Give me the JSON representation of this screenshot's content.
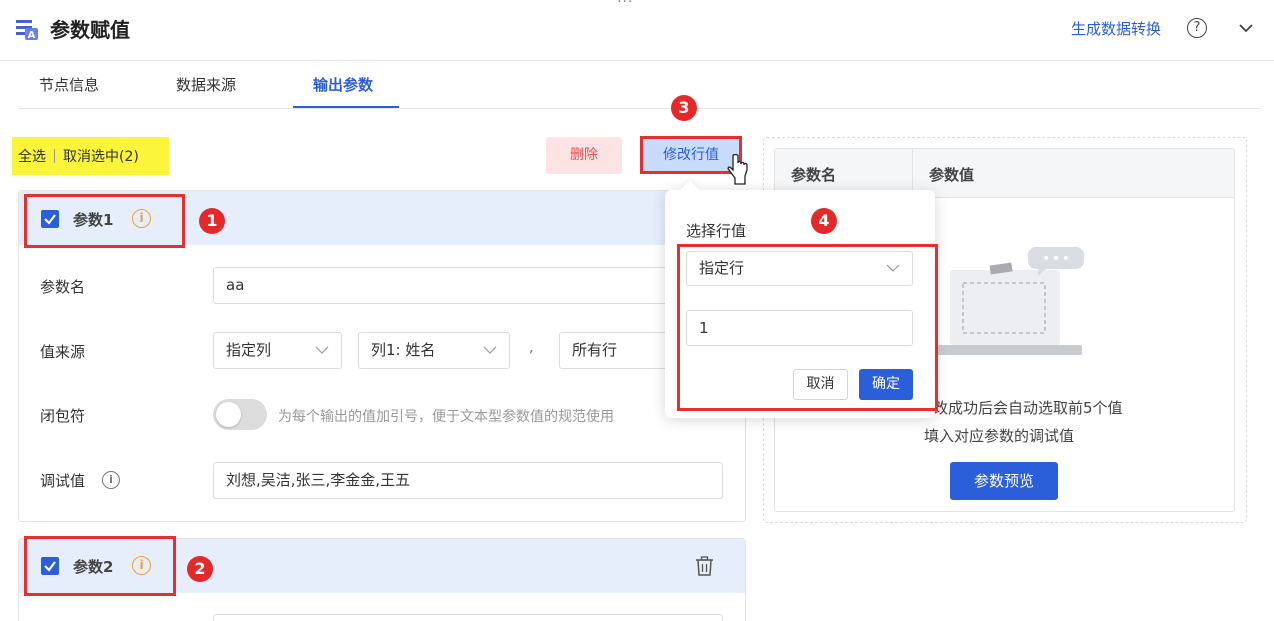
{
  "header": {
    "drag_handle": "···",
    "title": "参数赋值",
    "convert_link": "生成数据转换",
    "help_glyph": "?",
    "app_icon": "param-assign-icon",
    "collapse_icon": "chevron-down-icon"
  },
  "tabs": [
    {
      "label": "节点信息",
      "active": false
    },
    {
      "label": "数据来源",
      "active": false
    },
    {
      "label": "输出参数",
      "active": true
    }
  ],
  "toolbar": {
    "select_all": "全选",
    "deselect": "取消选中(2)",
    "delete_label": "删除",
    "modify_label": "修改行值"
  },
  "markers": [
    "1",
    "2",
    "3",
    "4"
  ],
  "params": [
    {
      "title": "参数1",
      "name_label": "参数名",
      "name_value": "aa",
      "source_label": "值来源",
      "source_type": "指定列",
      "source_column": "列1: 姓名",
      "separator": ",",
      "source_rows": "所有行",
      "wrapper_label": "闭包符",
      "wrapper_hint": "为每个输出的值加引号，便于文本型参数值的规范使用",
      "debug_label": "调试值",
      "debug_value": "刘想,吴洁,张三,李金金,王五"
    },
    {
      "title": "参数2"
    }
  ],
  "info_glyph": "i",
  "preview": {
    "col_name": "参数名",
    "col_value": "参数值",
    "empty_line1": "改成功后会自动选取前5个值",
    "empty_line2": "填入对应参数的调试值",
    "preview_button": "参数预览"
  },
  "popover": {
    "label": "选择行值",
    "row_mode": "指定行",
    "row_value": "1",
    "cancel": "取消",
    "confirm": "确定"
  },
  "colors": {
    "accent": "#2b5fd9",
    "highlight": "#faf43a",
    "danger": "#e53030",
    "warning": "#f0a030"
  }
}
